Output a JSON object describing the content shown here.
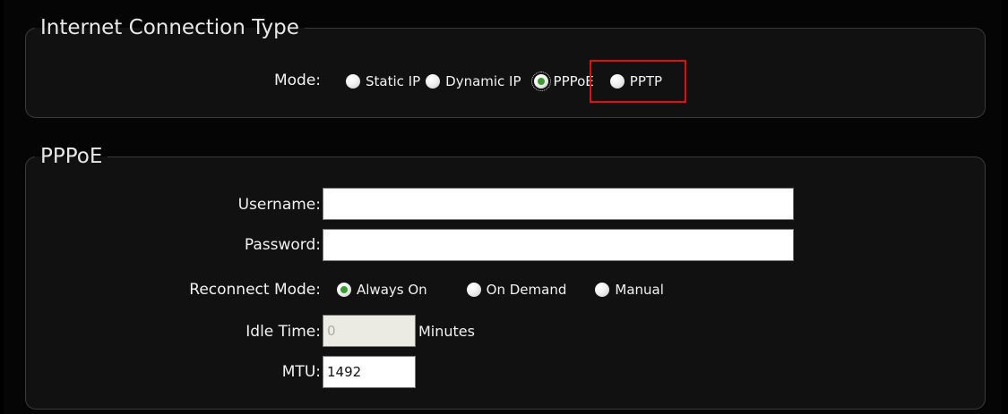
{
  "connection": {
    "legend": "Internet Connection Type",
    "mode_label": "Mode:",
    "options": [
      {
        "label": "Static IP",
        "selected": false
      },
      {
        "label": "Dynamic IP",
        "selected": false
      },
      {
        "label": "PPPoE",
        "selected": true
      },
      {
        "label": "PPTP",
        "selected": false
      }
    ]
  },
  "pppoe": {
    "legend": "PPPoE",
    "username_label": "Username:",
    "username_value": "",
    "password_label": "Password:",
    "password_value": "",
    "reconnect_label": "Reconnect Mode:",
    "reconnect_options": [
      {
        "label": "Always On",
        "selected": true
      },
      {
        "label": "On Demand",
        "selected": false
      },
      {
        "label": "Manual",
        "selected": false
      }
    ],
    "idle_label": "Idle Time:",
    "idle_value": "0",
    "idle_unit": "Minutes",
    "mtu_label": "MTU:",
    "mtu_value": "1492"
  },
  "colors": {
    "highlight_border": "#e01010",
    "radio_selected": "#3b9b2e",
    "panel_bg": "#111111"
  }
}
